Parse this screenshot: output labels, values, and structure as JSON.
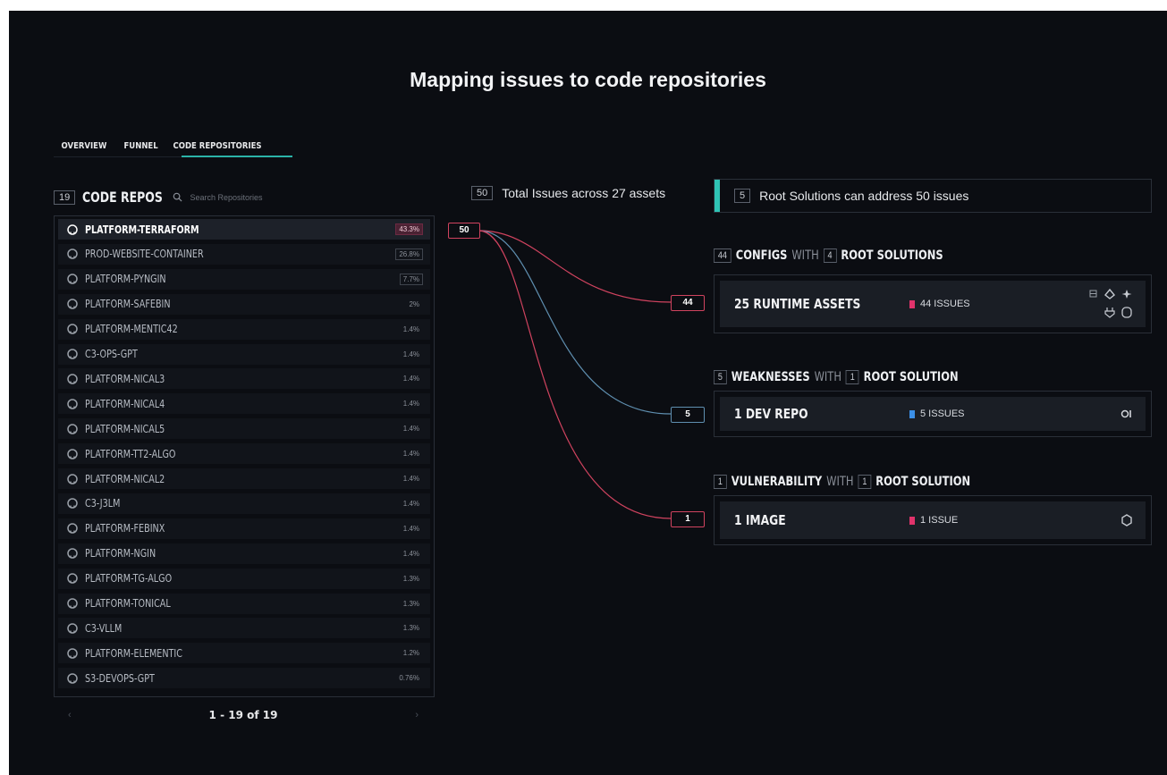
{
  "title": "Mapping issues to code repositories",
  "tabs": [
    {
      "label": "OVERVIEW"
    },
    {
      "label": "FUNNEL"
    },
    {
      "label": "CODE REPOSITORIES"
    }
  ],
  "repos": {
    "count": "19",
    "label": "CODE REPOS",
    "search_placeholder": "Search Repositories",
    "items": [
      {
        "name": "PLATFORM-TERRAFORM",
        "pct": "43.3%"
      },
      {
        "name": "PROD-WEBSITE-CONTAINER",
        "pct": "26.8%"
      },
      {
        "name": "PLATFORM-PYNGIN",
        "pct": "7.7%"
      },
      {
        "name": "PLATFORM-SAFEBIN",
        "pct": "2%"
      },
      {
        "name": "PLATFORM-MENTIC42",
        "pct": "1.4%"
      },
      {
        "name": "C3-OPS-GPT",
        "pct": "1.4%"
      },
      {
        "name": "PLATFORM-NICAL3",
        "pct": "1.4%"
      },
      {
        "name": "PLATFORM-NICAL4",
        "pct": "1.4%"
      },
      {
        "name": "PLATFORM-NICAL5",
        "pct": "1.4%"
      },
      {
        "name": "PLATFORM-TT2-ALGO",
        "pct": "1.4%"
      },
      {
        "name": "PLATFORM-NICAL2",
        "pct": "1.4%"
      },
      {
        "name": "C3-J3LM",
        "pct": "1.4%"
      },
      {
        "name": "PLATFORM-FEBINX",
        "pct": "1.4%"
      },
      {
        "name": "PLATFORM-NGIN",
        "pct": "1.4%"
      },
      {
        "name": "PLATFORM-TG-ALGO",
        "pct": "1.3%"
      },
      {
        "name": "PLATFORM-TONICAL",
        "pct": "1.3%"
      },
      {
        "name": "C3-VLLM",
        "pct": "1.3%"
      },
      {
        "name": "PLATFORM-ELEMENTIC",
        "pct": "1.2%"
      },
      {
        "name": "S3-DEVOPS-GPT",
        "pct": "0.76%"
      }
    ],
    "pager": {
      "label": "1 - 19 of 19",
      "prev": "‹",
      "next": "›"
    }
  },
  "summary": {
    "total_count": "50",
    "total_text": "Total Issues across 27 assets",
    "root_count": "5",
    "root_text": "Root Solutions can address 50 issues"
  },
  "flow": {
    "source": "50",
    "targets": [
      "44",
      "5",
      "1"
    ]
  },
  "groups": [
    {
      "count": "44",
      "type": "CONFIGS",
      "with": "WITH",
      "root_count": "4",
      "root_label": "ROOT SOLUTIONS",
      "card_name": "25  RUNTIME ASSETS",
      "issues": "44 ISSUES",
      "color": "#e0336b",
      "icons": [
        "grid-icon",
        "shield-drop-icon",
        "sparkle-icon",
        "plug-icon",
        "cylinder-icon"
      ]
    },
    {
      "count": "5",
      "type": "WEAKNESSES",
      "with": "WITH",
      "root_count": "1",
      "root_label": "ROOT SOLUTION",
      "card_name": "1  DEV REPO",
      "issues": "5 ISSUES",
      "color": "#3b8fe6",
      "icons": [
        "repo-icon"
      ]
    },
    {
      "count": "1",
      "type": "VULNERABILITY",
      "with": "WITH",
      "root_count": "1",
      "root_label": "ROOT SOLUTION",
      "card_name": "1  IMAGE",
      "issues": "1 ISSUE",
      "color": "#e0336b",
      "icons": [
        "image-icon"
      ]
    }
  ],
  "colors": {
    "background": "#0b0d12",
    "accent": "#2fc4b5",
    "config_flow": "#d0435f",
    "weakness_flow": "#5f8fb0"
  }
}
